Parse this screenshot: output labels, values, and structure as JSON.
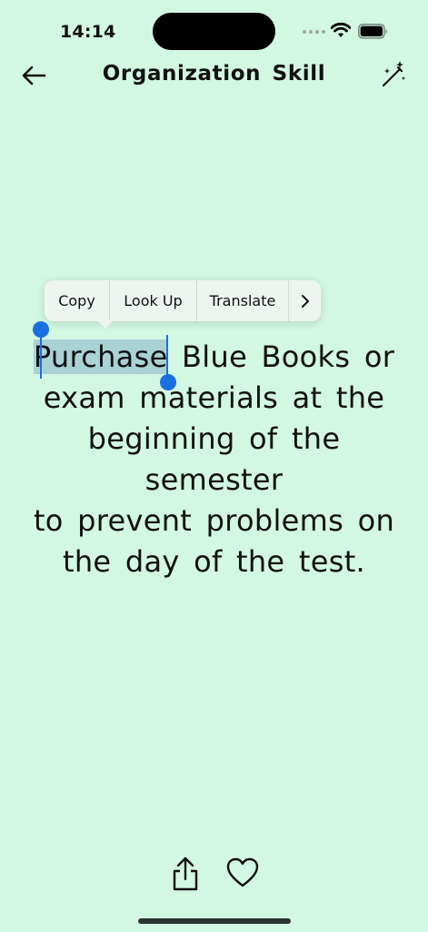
{
  "status": {
    "time": "14:14"
  },
  "header": {
    "title": "Organization Skill",
    "back_icon": "arrow-left-icon",
    "action_icon": "magic-wand-icon"
  },
  "context_menu": {
    "items": [
      "Copy",
      "Look Up",
      "Translate"
    ],
    "more_icon": "chevron-right-icon"
  },
  "quote": {
    "selected_word": "Purchase",
    "rest_line1": "Blue Books or",
    "line2": "exam materials at the",
    "line3": "beginning of the semester",
    "line4": "to prevent problems on",
    "line5": "the day of the test."
  },
  "footer": {
    "share_icon": "share-icon",
    "favorite_icon": "heart-icon"
  },
  "colors": {
    "background": "#d2f7e3",
    "selection": "#a9d2d5",
    "selection_handle": "#1a6fe0"
  }
}
